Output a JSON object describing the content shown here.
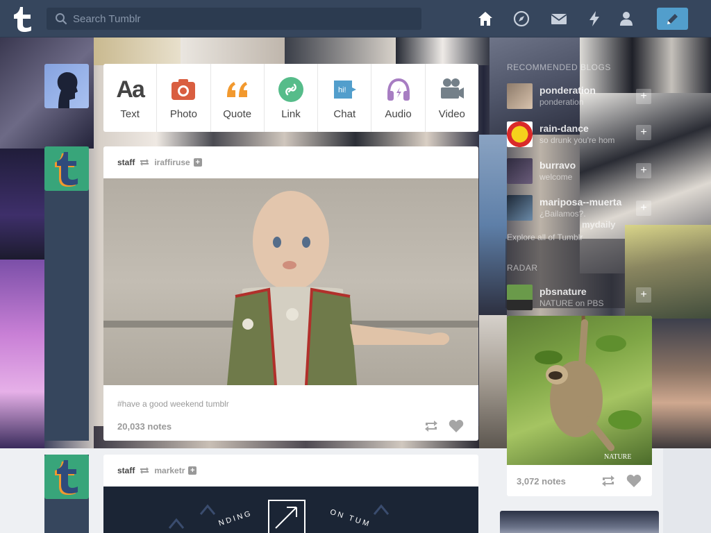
{
  "header": {
    "search_placeholder": "Search Tumblr",
    "nav": [
      "home-icon",
      "explore-icon",
      "messages-icon",
      "activity-icon",
      "account-icon"
    ],
    "compose_icon": "pencil-icon"
  },
  "colors": {
    "brand": "#36465d",
    "compose": "#529ecc",
    "text_post": "#444444",
    "photo": "#d95e40",
    "quote": "#f2992e",
    "link": "#56bc8a",
    "chat": "#529ecc",
    "audio": "#a77dc2",
    "video": "#748089"
  },
  "composer": {
    "items": [
      {
        "label": "Text",
        "icon": "text-icon"
      },
      {
        "label": "Photo",
        "icon": "camera-icon"
      },
      {
        "label": "Quote",
        "icon": "quote-icon"
      },
      {
        "label": "Link",
        "icon": "link-icon"
      },
      {
        "label": "Chat",
        "icon": "chat-icon"
      },
      {
        "label": "Audio",
        "icon": "headphones-icon"
      },
      {
        "label": "Video",
        "icon": "video-camera-icon"
      }
    ]
  },
  "posts": [
    {
      "user": "staff",
      "source": "iraffiruse",
      "tags": "#have a good weekend tumblr",
      "notes": "20,033 notes"
    },
    {
      "user": "staff",
      "source": "marketr",
      "banner_text_left": "NDING",
      "banner_text_right": "ON TUM"
    }
  ],
  "sidebar": {
    "recommended_title": "RECOMMENDED BLOGS",
    "blogs": [
      {
        "name": "ponderation",
        "desc": "ponderation"
      },
      {
        "name": "rain-dance",
        "desc": "so drunk you're hom"
      },
      {
        "name": "burravo",
        "desc": "welcome"
      },
      {
        "name": "mariposa--muerta",
        "desc": "¿Bailamos?."
      }
    ],
    "explore_text": "Explore all of Tumblr",
    "radar_title": "RADAR",
    "radar_blog": {
      "name": "pbsnature",
      "desc": "NATURE on PBS"
    },
    "radar_notes": "3,072 notes",
    "radar_logo_text": "NATURE",
    "collage_text": "mydaily"
  }
}
